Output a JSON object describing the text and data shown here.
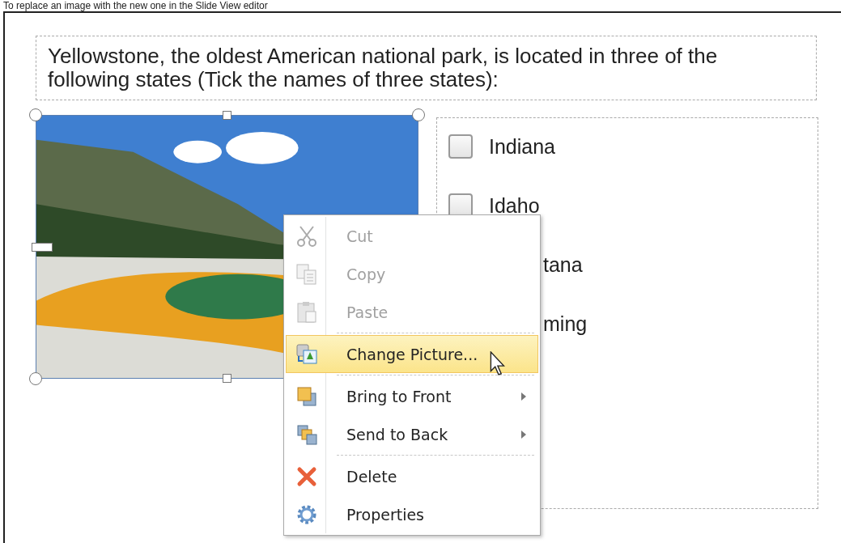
{
  "caption": "To replace an image with the new one in the Slide View editor",
  "question": "Yellowstone, the oldest American national park, is located in three of the following states (Tick the names of three states):",
  "options": [
    {
      "label": "Indiana",
      "checked": false,
      "kind": "full"
    },
    {
      "label": "Idaho",
      "checked": false,
      "kind": "full"
    },
    {
      "label": "tana",
      "kind": "clipped"
    },
    {
      "label": "ming",
      "kind": "clipped"
    }
  ],
  "context_menu": [
    {
      "label": "Cut",
      "kind": "scissors",
      "disabled": true,
      "selected": false,
      "submenu": false,
      "divider_after": false
    },
    {
      "label": "Copy",
      "kind": "copy",
      "disabled": true,
      "selected": false,
      "submenu": false,
      "divider_after": false
    },
    {
      "label": "Paste",
      "kind": "paste",
      "disabled": true,
      "selected": false,
      "submenu": false,
      "divider_after": true
    },
    {
      "label": "Change Picture...",
      "kind": "picture",
      "disabled": false,
      "selected": true,
      "submenu": false,
      "divider_after": true
    },
    {
      "label": "Bring to Front",
      "kind": "front",
      "disabled": false,
      "selected": false,
      "submenu": true,
      "divider_after": false
    },
    {
      "label": "Send to Back",
      "kind": "back",
      "disabled": false,
      "selected": false,
      "submenu": true,
      "divider_after": true
    },
    {
      "label": "Delete",
      "kind": "delete",
      "disabled": false,
      "selected": false,
      "submenu": false,
      "divider_after": false
    },
    {
      "label": "Properties",
      "kind": "gear",
      "disabled": false,
      "selected": false,
      "submenu": false,
      "divider_after": false
    }
  ]
}
